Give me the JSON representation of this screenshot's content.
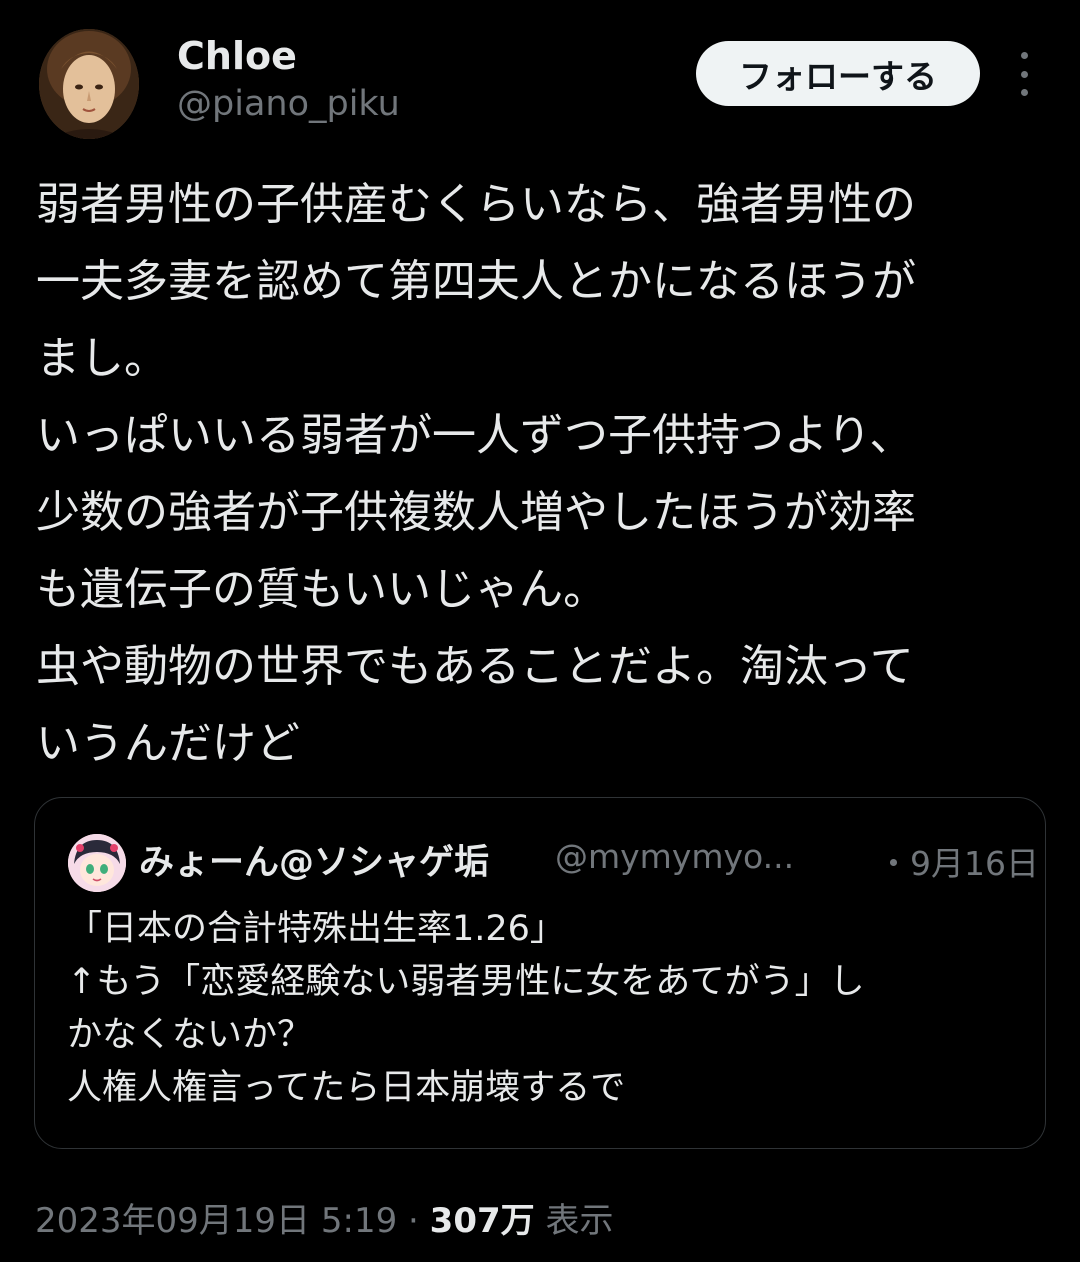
{
  "tweet": {
    "author": {
      "name": "Chloe",
      "handle": "@piano_piku"
    },
    "follow_label": "フォローする",
    "text_lines": [
      "弱者男性の子供産むくらいなら、強者男性の",
      "一夫多妻を認めて第四夫人とかになるほうが",
      "まし。",
      "いっぱいいる弱者が一人ずつ子供持つより、",
      "少数の強者が子供複数人増やしたほうが効率",
      "も遺伝子の質もいいじゃん。",
      "虫や動物の世界でもあることだよ。淘汰って",
      "いうんだけど"
    ],
    "quote": {
      "name": "みょーん@ソシャゲ垢",
      "handle": "@mymymyo...",
      "date": "・9月16日",
      "text_lines": [
        "「日本の合計特殊出生率1.26」",
        "↑もう「恋愛経験ない弱者男性に女をあてがう」し",
        "かなくないか？",
        "人権人権言ってたら日本崩壊するで"
      ]
    },
    "meta": {
      "timestamp": "2023年09月19日 5:19",
      "separator": " · ",
      "views_count": "307万",
      "views_label": " 表示"
    }
  },
  "colors": {
    "background": "#000000",
    "primary_text": "#e7e9ea",
    "secondary_text": "#71767b",
    "border": "#2f3336",
    "follow_button_bg": "#eff3f4"
  },
  "icons": {
    "more": "more-vertical-icon"
  }
}
